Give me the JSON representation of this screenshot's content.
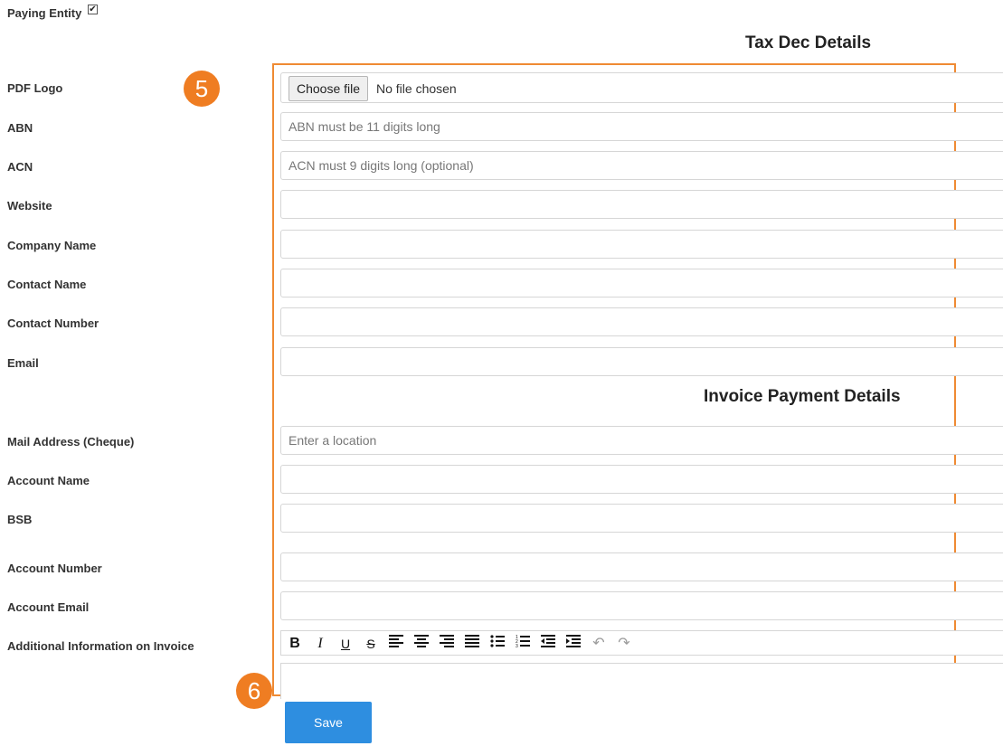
{
  "paying_entity": {
    "label": "Paying Entity",
    "checked": true
  },
  "sections": {
    "tax_dec": "Tax Dec Details",
    "invoice_payment": "Invoice Payment Details"
  },
  "badges": {
    "step_5": "5",
    "step_6": "6"
  },
  "pdf_logo": {
    "label": "PDF Logo",
    "button": "Choose file",
    "status": "No file chosen"
  },
  "fields": {
    "abn": {
      "label": "ABN",
      "placeholder": "ABN must be 11 digits long",
      "value": ""
    },
    "acn": {
      "label": "ACN",
      "placeholder": "ACN must 9 digits long (optional)",
      "value": ""
    },
    "website": {
      "label": "Website",
      "placeholder": "",
      "value": ""
    },
    "company_name": {
      "label": "Company Name",
      "placeholder": "",
      "value": ""
    },
    "contact_name": {
      "label": "Contact Name",
      "placeholder": "",
      "value": ""
    },
    "contact_number": {
      "label": "Contact Number",
      "placeholder": "",
      "value": ""
    },
    "email": {
      "label": "Email",
      "placeholder": "",
      "value": ""
    },
    "mail_address": {
      "label": "Mail Address (Cheque)",
      "placeholder": "Enter a location",
      "value": ""
    },
    "account_name": {
      "label": "Account Name",
      "placeholder": "",
      "value": ""
    },
    "bsb": {
      "label": "BSB",
      "placeholder": "",
      "value": ""
    },
    "account_number": {
      "label": "Account Number",
      "placeholder": "",
      "value": ""
    },
    "account_email": {
      "label": "Account Email",
      "placeholder": "",
      "value": ""
    }
  },
  "additional_info": {
    "label": "Additional Information on Invoice"
  },
  "toolbar": {
    "bold": "B",
    "italic": "I",
    "underline": "U",
    "strike": "S",
    "undo": "↶",
    "redo": "↷"
  },
  "actions": {
    "save": "Save"
  },
  "colors": {
    "accent_orange": "#ef7d22",
    "primary_blue": "#2e8ee0"
  }
}
